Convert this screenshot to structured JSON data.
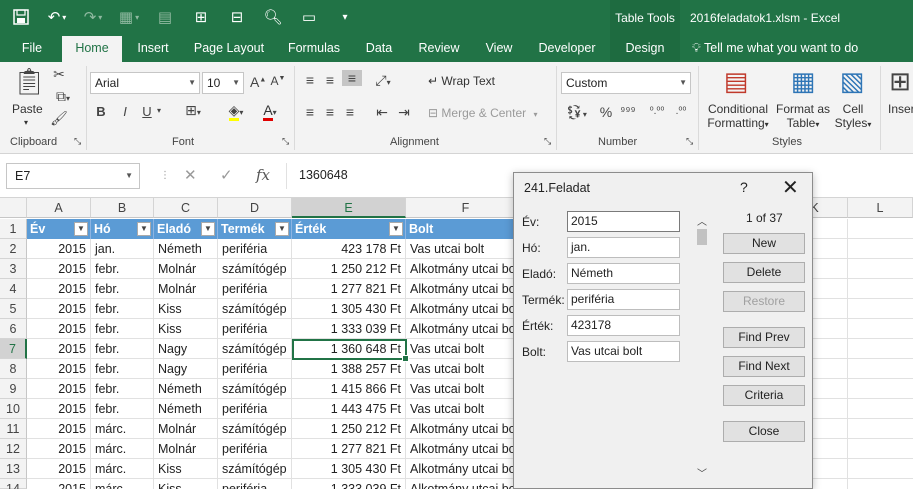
{
  "window": {
    "title": "2016feladatok1.xlsm - Excel",
    "contextual_tab_group": "Table Tools"
  },
  "tabs": [
    "File",
    "Home",
    "Insert",
    "Page Layout",
    "Formulas",
    "Data",
    "Review",
    "View",
    "Developer",
    "Design"
  ],
  "active_tab": "Home",
  "tell_me": "Tell me what you want to do",
  "ribbon": {
    "clipboard": {
      "label": "Clipboard",
      "paste": "Paste"
    },
    "font": {
      "label": "Font",
      "name": "Arial",
      "size": "10",
      "bold": "B",
      "italic": "I",
      "underline": "U"
    },
    "alignment": {
      "label": "Alignment",
      "wrap_text": "Wrap Text",
      "merge_center": "Merge & Center"
    },
    "number": {
      "label": "Number",
      "format": "Custom",
      "percent": "%"
    },
    "styles": {
      "label": "Styles",
      "conditional_1": "Conditional",
      "conditional_2": "Formatting",
      "format_table_1": "Format as",
      "format_table_2": "Table",
      "cell_styles_1": "Cell",
      "cell_styles_2": "Styles"
    },
    "insert_partial": "Inser"
  },
  "formula_bar": {
    "name_box": "E7",
    "value": "1360648"
  },
  "columns": [
    "A",
    "B",
    "C",
    "D",
    "E",
    "F",
    "",
    "K",
    "L"
  ],
  "selected_column": "E",
  "table": {
    "headers": [
      "Év",
      "Hó",
      "Eladó",
      "Termék",
      "Érték",
      "Bolt"
    ],
    "rows": [
      [
        "2015",
        "jan.",
        "Németh",
        "periféria",
        "423 178 Ft",
        "Vas utcai bolt"
      ],
      [
        "2015",
        "febr.",
        "Molnár",
        "számítógép",
        "1 250 212 Ft",
        "Alkotmány utcai bolt"
      ],
      [
        "2015",
        "febr.",
        "Molnár",
        "periféria",
        "1 277 821 Ft",
        "Alkotmány utcai bolt"
      ],
      [
        "2015",
        "febr.",
        "Kiss",
        "számítógép",
        "1 305 430 Ft",
        "Alkotmány utcai bolt"
      ],
      [
        "2015",
        "febr.",
        "Kiss",
        "periféria",
        "1 333 039 Ft",
        "Alkotmány utcai bolt"
      ],
      [
        "2015",
        "febr.",
        "Nagy",
        "számítógép",
        "1 360 648 Ft",
        "Vas utcai bolt"
      ],
      [
        "2015",
        "febr.",
        "Nagy",
        "periféria",
        "1 388 257 Ft",
        "Vas utcai bolt"
      ],
      [
        "2015",
        "febr.",
        "Németh",
        "számítógép",
        "1 415 866 Ft",
        "Vas utcai bolt"
      ],
      [
        "2015",
        "febr.",
        "Németh",
        "periféria",
        "1 443 475 Ft",
        "Vas utcai bolt"
      ],
      [
        "2015",
        "márc.",
        "Molnár",
        "számítógép",
        "1 250 212 Ft",
        "Alkotmány utcai bolt"
      ],
      [
        "2015",
        "márc.",
        "Molnár",
        "periféria",
        "1 277 821 Ft",
        "Alkotmány utcai bolt"
      ],
      [
        "2015",
        "márc.",
        "Kiss",
        "számítógép",
        "1 305 430 Ft",
        "Alkotmány utcai bolt"
      ],
      [
        "2015",
        "márc.",
        "Kiss",
        "periféria",
        "1 333 039 Ft",
        "Alkotmány utcai bolt"
      ]
    ],
    "row_numbers": [
      "1",
      "2",
      "3",
      "4",
      "5",
      "6",
      "7",
      "8",
      "9",
      "10",
      "11",
      "12",
      "13",
      "14"
    ],
    "active_row": "7"
  },
  "dialog": {
    "title": "241.Feladat",
    "help": "?",
    "close": "✕",
    "counter": "1 of 37",
    "fields": [
      {
        "label": "Év:",
        "value": "2015"
      },
      {
        "label": "Hó:",
        "value": "jan."
      },
      {
        "label": "Eladó:",
        "value": "Németh"
      },
      {
        "label": "Termék:",
        "value": "periféria"
      },
      {
        "label": "Érték:",
        "value": "423178"
      },
      {
        "label": "Bolt:",
        "value": "Vas utcai bolt"
      }
    ],
    "buttons": {
      "new": "New",
      "delete": "Delete",
      "restore": "Restore",
      "find_prev": "Find Prev",
      "find_next": "Find Next",
      "criteria": "Criteria",
      "close": "Close"
    }
  },
  "colors": {
    "excel_green": "#217346",
    "table_header": "#5b9bd5",
    "dialog_bg": "#f0f0f0"
  }
}
